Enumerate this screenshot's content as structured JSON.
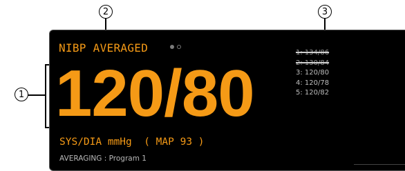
{
  "callouts": {
    "c1": "1",
    "c2": "2",
    "c3": "3"
  },
  "panel": {
    "title": "NIBP AVERAGED",
    "value": "120/80",
    "units": "SYS/DIA mmHg  ( MAP 93 )",
    "averaging": "AVERAGING : Program 1",
    "page_indicator": {
      "total": 2,
      "active": 1
    },
    "history": [
      {
        "label": "1: 134/86",
        "excluded": true
      },
      {
        "label": "2: 130/84",
        "excluded": true
      },
      {
        "label": "3: 120/80",
        "excluded": false
      },
      {
        "label": "4: 120/78",
        "excluded": false
      },
      {
        "label": "5: 120/82",
        "excluded": false
      }
    ]
  },
  "colors": {
    "accent": "#f59a16",
    "background": "#000000",
    "muted": "#bdbdbd"
  }
}
